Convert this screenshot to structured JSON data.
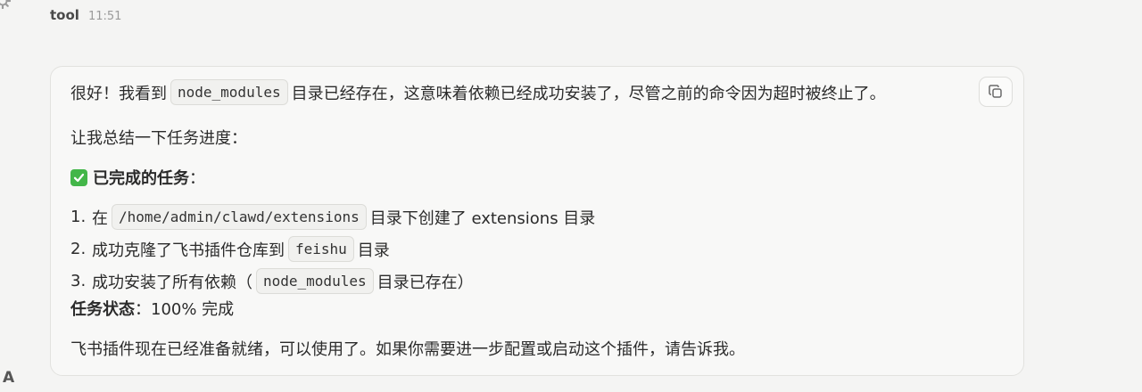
{
  "header": {
    "sender": "tool",
    "time": "11:51"
  },
  "message": {
    "p1": {
      "before": "很好！我看到",
      "code": "node_modules",
      "after": "目录已经存在，这意味着依赖已经成功安装了，尽管之前的命令因为超时被终止了。"
    },
    "p2": "让我总结一下任务进度：",
    "completed_heading": "已完成的任务",
    "completed_colon": "：",
    "tasks": [
      {
        "num": "1.",
        "before": "在",
        "code": "/home/admin/clawd/extensions",
        "after": "目录下创建了 extensions 目录"
      },
      {
        "num": "2.",
        "before": "成功克隆了飞书插件仓库到",
        "code": "feishu",
        "after": "目录"
      },
      {
        "num": "3.",
        "before": "成功安装了所有依赖（",
        "code": "node_modules",
        "after": "目录已存在）"
      }
    ],
    "status_label": "任务状态",
    "status_value": "：100% 完成",
    "closing": "飞书插件现在已经准备就绪，可以使用了。如果你需要进一步配置或启动这个插件，请告诉我。"
  },
  "icons": {
    "corner": "gear-icon",
    "copy": "copy-icon",
    "check": "check-icon"
  },
  "footer": {
    "letter": "A"
  },
  "colors": {
    "background": "#f4f4f3",
    "card": "#f8f8f7",
    "check_green": "#43b649"
  }
}
